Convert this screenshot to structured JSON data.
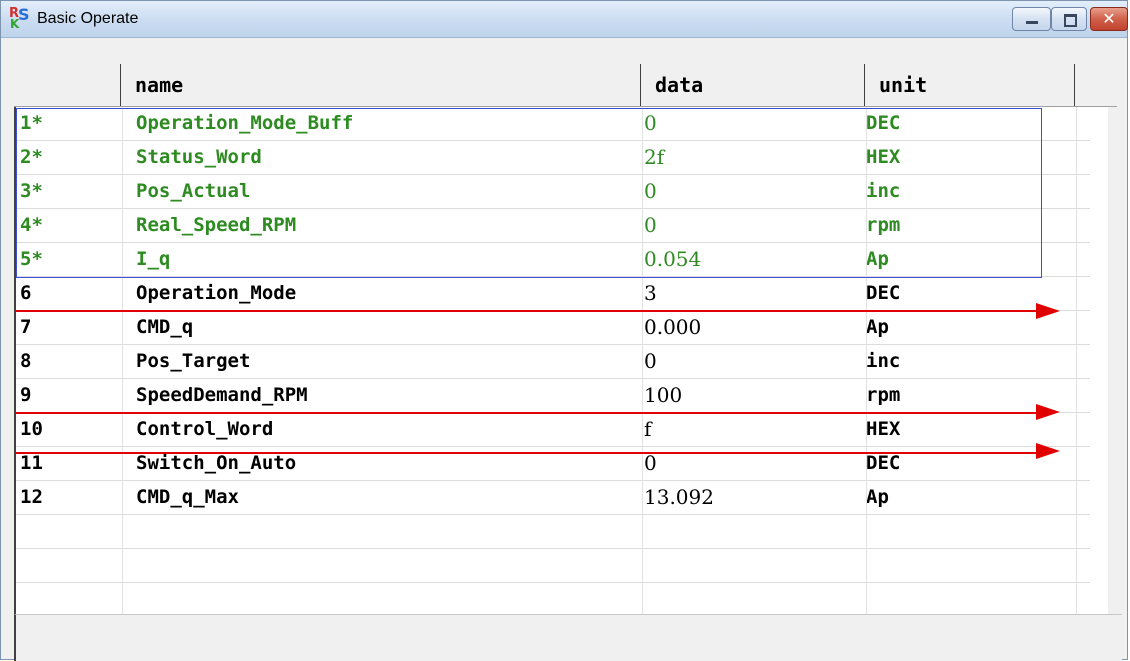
{
  "window": {
    "title": "Basic Operate",
    "app_icon": "rs-logo-icon",
    "controls": {
      "minimize_icon": "minimize-icon",
      "maximize_icon": "maximize-icon",
      "close_icon": "close-icon",
      "close_glyph": "✕"
    }
  },
  "table": {
    "columns": [
      {
        "key": "no",
        "label": ""
      },
      {
        "key": "name",
        "label": "name"
      },
      {
        "key": "data",
        "label": "data"
      },
      {
        "key": "unit",
        "label": "unit"
      }
    ],
    "rows": [
      {
        "no": "1*",
        "name": "Operation_Mode_Buff",
        "data": "0",
        "unit": "DEC",
        "color": "#2e8b22"
      },
      {
        "no": "2*",
        "name": "Status_Word",
        "data": "2f",
        "unit": "HEX",
        "color": "#2e8b22"
      },
      {
        "no": "3*",
        "name": "Pos_Actual",
        "data": "0",
        "unit": "inc",
        "color": "#2e8b22"
      },
      {
        "no": "4*",
        "name": "Real_Speed_RPM",
        "data": "0",
        "unit": "rpm",
        "color": "#2e8b22"
      },
      {
        "no": "5*",
        "name": "I_q",
        "data": "0.054",
        "unit": "Ap",
        "color": "#2e8b22"
      },
      {
        "no": "6",
        "name": "Operation_Mode",
        "data": "3",
        "unit": "DEC",
        "color": "#000000"
      },
      {
        "no": "7",
        "name": "CMD_q",
        "data": "0.000",
        "unit": "Ap",
        "color": "#000000"
      },
      {
        "no": "8",
        "name": "Pos_Target",
        "data": "0",
        "unit": "inc",
        "color": "#000000"
      },
      {
        "no": "9",
        "name": "SpeedDemand_RPM",
        "data": "100",
        "unit": "rpm",
        "color": "#000000"
      },
      {
        "no": "10",
        "name": "Control_Word",
        "data": "f",
        "unit": "HEX",
        "color": "#000000"
      },
      {
        "no": "11",
        "name": "Switch_On_Auto",
        "data": "0",
        "unit": "DEC",
        "color": "#000000"
      },
      {
        "no": "12",
        "name": "CMD_q_Max",
        "data": "13.092",
        "unit": "Ap",
        "color": "#000000"
      }
    ]
  },
  "colors": {
    "monitored_text": "#2e8b22",
    "selection_border": "#3c4fd6",
    "annotation_arrow": "#e00000"
  }
}
